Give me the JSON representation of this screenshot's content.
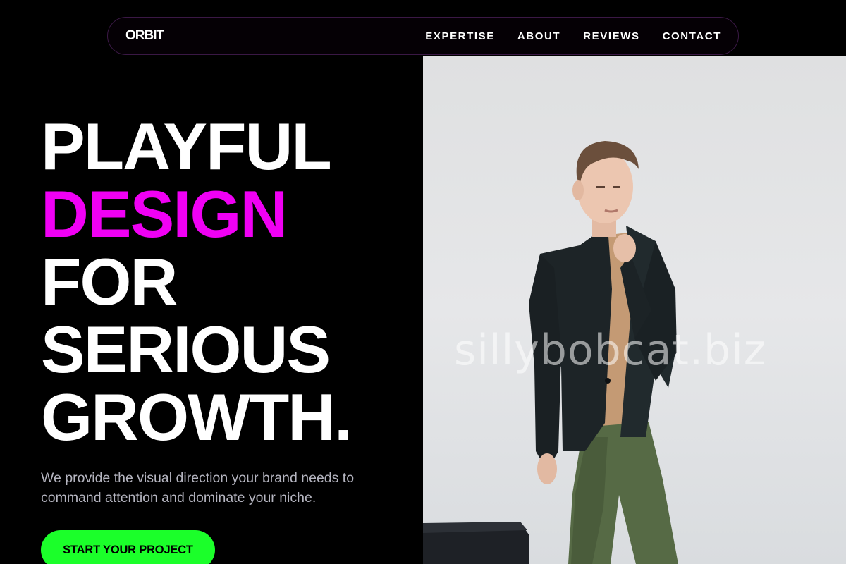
{
  "nav": {
    "logo": "ORBIT",
    "links": [
      {
        "label": "EXPERTISE"
      },
      {
        "label": "ABOUT"
      },
      {
        "label": "REVIEWS"
      },
      {
        "label": "CONTACT"
      }
    ]
  },
  "hero": {
    "headline": [
      "PLAYFUL",
      "DESIGN",
      "FOR",
      "SERIOUS",
      "GROWTH."
    ],
    "accent_color": "#f000f4",
    "subtext": "We provide the visual direction your brand needs to command attention and dominate your niche.",
    "cta_label": "START YOUR PROJECT",
    "cta_color": "#1bff2a",
    "watermark": "sillybobcat.biz"
  }
}
